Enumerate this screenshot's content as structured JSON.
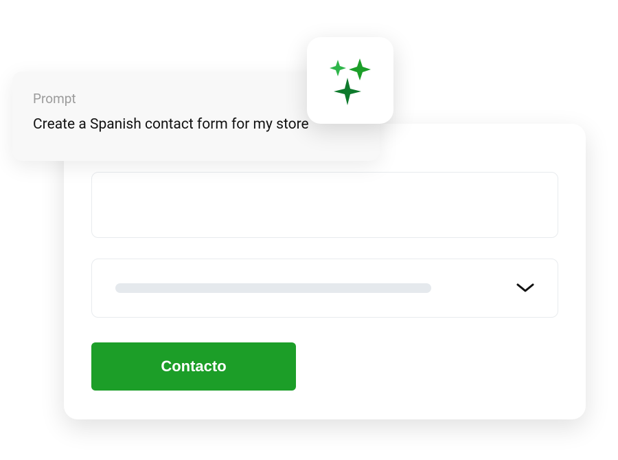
{
  "prompt": {
    "label": "Prompt",
    "text": "Create a Spanish contact form for my store"
  },
  "form": {
    "submit_label": "Contacto"
  },
  "colors": {
    "accent": "#1c9e28",
    "sparkle_light": "#2eb54a",
    "sparkle_dark": "#0e7a2c"
  }
}
